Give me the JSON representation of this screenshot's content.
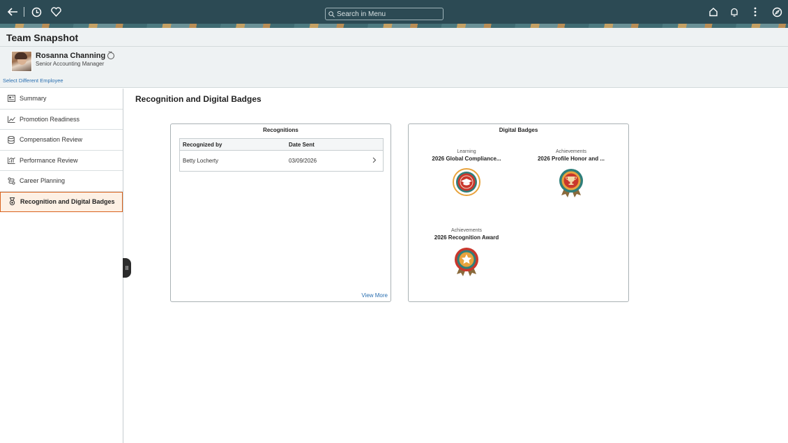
{
  "header": {
    "search_placeholder": "Search in Menu",
    "icons": [
      "back-arrow-icon",
      "recent-icon",
      "favorite-icon",
      "home-icon",
      "notification-icon",
      "actions-icon",
      "navbar-icon"
    ]
  },
  "page": {
    "title": "Team Snapshot"
  },
  "employee": {
    "name": "Rosanna Channing",
    "job_title": "Senior Accounting Manager",
    "select_link": "Select Different Employee"
  },
  "sidebar": {
    "items": [
      {
        "label": "Summary",
        "icon": "summary-icon"
      },
      {
        "label": "Promotion Readiness",
        "icon": "line-chart-icon"
      },
      {
        "label": "Compensation Review",
        "icon": "database-icon"
      },
      {
        "label": "Performance Review",
        "icon": "bar-chart-icon"
      },
      {
        "label": "Career Planning",
        "icon": "path-icon"
      },
      {
        "label": "Recognition and Digital Badges",
        "icon": "medal-icon",
        "active": true
      }
    ]
  },
  "main": {
    "title": "Recognition and Digital Badges",
    "recognitions": {
      "title": "Recognitions",
      "columns": [
        "Recognized by",
        "Date Sent"
      ],
      "rows": [
        {
          "recognized_by": "Betty Locherty",
          "date_sent": "03/09/2026"
        }
      ],
      "view_more": "View More"
    },
    "badges": {
      "title": "Digital Badges",
      "items": [
        {
          "category": "Learning",
          "name": "2026 Global Compliance...",
          "icon": "graduation-cap-badge-icon"
        },
        {
          "category": "Achievements",
          "name": "2026 Profile Honor and ...",
          "icon": "trophy-badge-icon"
        },
        {
          "category": "Achievements",
          "name": "2026 Recognition Award",
          "icon": "star-badge-icon"
        }
      ]
    }
  },
  "colors": {
    "header_bg": "#2c4a54",
    "active_border": "#d9631e",
    "active_bg": "#fdf0e4",
    "link": "#2a6fb0",
    "badge_primary": "#c9372c",
    "badge_accent": "#e8a33d",
    "badge_teal": "#2f7f7b"
  }
}
